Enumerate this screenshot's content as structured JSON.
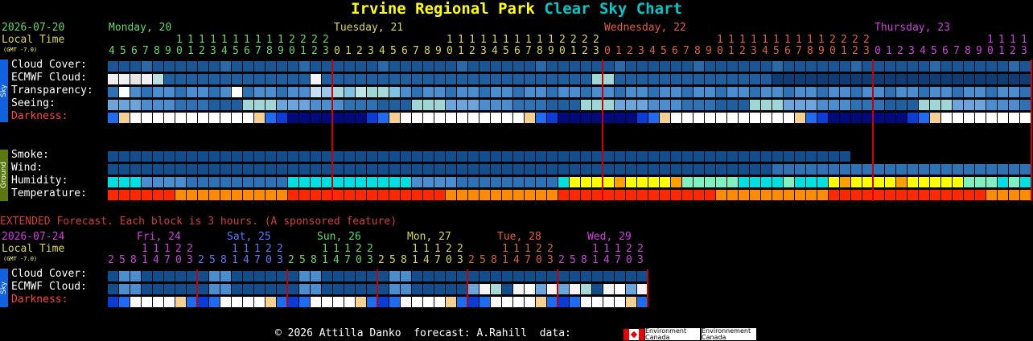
{
  "header": {
    "title_place": "Irvine Regional Park",
    "title_chart": "Clear Sky Chart",
    "date": "2026-07-20",
    "local_time": "Local Time",
    "gmt": "(GMT -7.0)"
  },
  "days": [
    {
      "label": "Monday, 20",
      "color": "#66d966"
    },
    {
      "label": "Tuesday, 21",
      "color": "#d9d94a"
    },
    {
      "label": "Wednesday, 22",
      "color": "#e0603a"
    },
    {
      "label": "Thursday, 23",
      "color": "#d040e0"
    }
  ],
  "hour_tens": "1111111222222           111111111112222222          1111111111112222222          11111111111122222",
  "hour_ones": "456789012301234567890123456789012301234567890123456789012301234567890123456789012301234567890123",
  "rows_sky": [
    {
      "label": "Cloud Cover:"
    },
    {
      "label": "ECMWF Cloud:"
    },
    {
      "label": "Transparency:"
    },
    {
      "label": "Seeing:"
    },
    {
      "label": "Darkness:"
    }
  ],
  "rows_ground": [
    {
      "label": "Smoke:"
    },
    {
      "label": "Wind:"
    },
    {
      "label": "Humidity:"
    },
    {
      "label": "Temperature:"
    }
  ],
  "tabs": {
    "sky": "Sky",
    "ground": "Ground"
  },
  "extended": {
    "note": "EXTENDED Forecast. Each block is 3 hours. (A sponsored feature)",
    "date": "2026-07-24",
    "local_time": "Local Time",
    "gmt": "(GMT -7.0)",
    "days": [
      {
        "label": "Fri, 24",
        "color": "#d040e0"
      },
      {
        "label": "Sat, 25",
        "color": "#5a7aff"
      },
      {
        "label": "Sun, 26",
        "color": "#66d966"
      },
      {
        "label": "Mon, 27",
        "color": "#d9d94a"
      },
      {
        "label": "Tue, 28",
        "color": "#e0603a"
      },
      {
        "label": "Wed, 29",
        "color": "#d040e0"
      }
    ],
    "hour_tens": " 11122",
    "hour_ones": "25814703",
    "rows": [
      {
        "label": "Cloud Cover:"
      },
      {
        "label": "ECMWF Cloud:"
      },
      {
        "label": "Darkness:"
      }
    ]
  },
  "footer": {
    "text": "© 2026 Attilla Danko  forecast: A.Rahill  data:",
    "env1": "Environment Canada",
    "env2": "Environnement Canada"
  },
  "colors": {
    "accent_yellow": "#ffff00",
    "accent_cyan": "#00c8c8",
    "midnight_line": "#cc0000"
  }
}
